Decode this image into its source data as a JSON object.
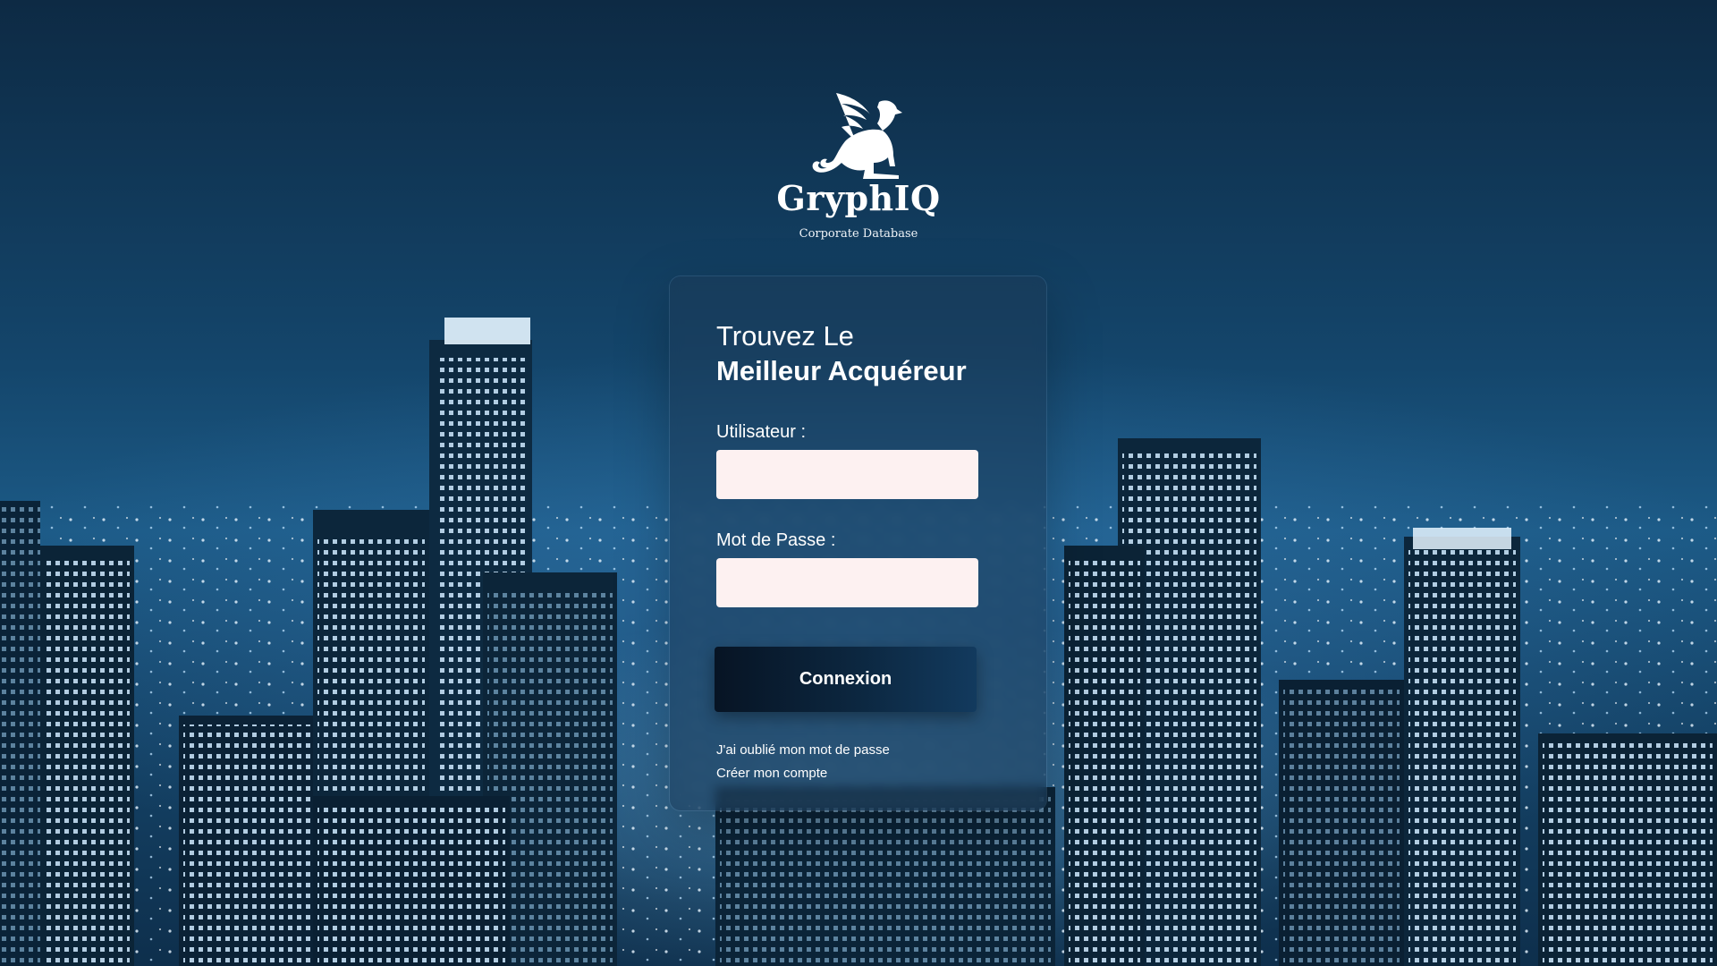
{
  "brand": {
    "name": "GryphIQ",
    "subtitle": "Corporate Database",
    "logo_icon": "gryphon-icon"
  },
  "login": {
    "title_line1": "Trouvez Le",
    "title_line2": "Meilleur Acquéreur",
    "username_label": "Utilisateur :",
    "username_value": "",
    "password_label": "Mot de Passe :",
    "password_value": "",
    "submit_label": "Connexion",
    "forgot_link": "J'ai oublié mon mot de passe",
    "create_link": "Créer mon compte"
  },
  "colors": {
    "input_background": "#fdf1f1",
    "button_dark": "#071424",
    "text": "#ffffff",
    "background_blue": "#1c5a86"
  }
}
